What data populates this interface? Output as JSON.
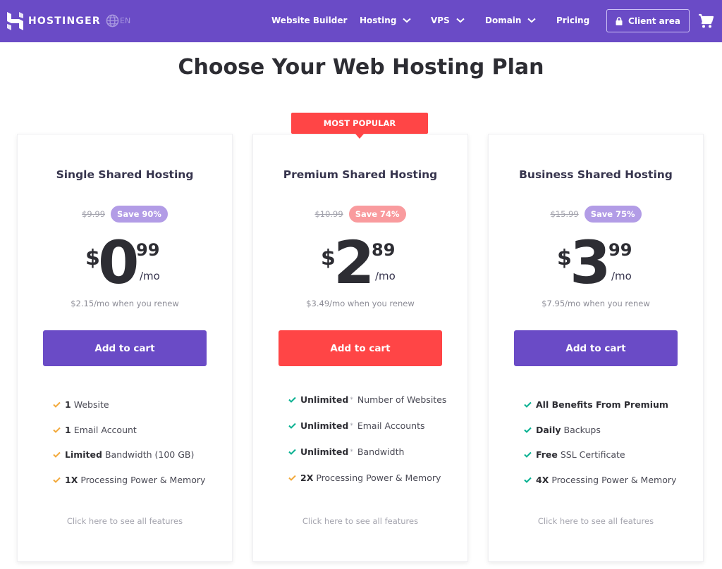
{
  "header": {
    "brand": "HOSTINGER",
    "language": "EN",
    "nav": [
      {
        "label": "Website Builder",
        "dropdown": false
      },
      {
        "label": "Hosting",
        "dropdown": true
      },
      {
        "label": "VPS",
        "dropdown": true
      },
      {
        "label": "Domain",
        "dropdown": true
      },
      {
        "label": "Pricing",
        "dropdown": false
      }
    ],
    "client_area": "Client area",
    "icons": {
      "logo": "hostinger-logo",
      "language": "globe-icon",
      "lock": "lock-icon",
      "cart": "shopping-cart-icon"
    }
  },
  "page_title": "Choose Your Web Hosting Plan",
  "colors": {
    "brand_purple": "#6a4bc6",
    "accent_red": "#ff4546",
    "badge_purple": "#b29ce6",
    "badge_pink": "#f99b9e",
    "check_green": "#00b090",
    "check_orange": "#f2a93b"
  },
  "plans": [
    {
      "name": "Single Shared Hosting",
      "old_price": "$9.99",
      "save": "Save 90%",
      "currency": "$",
      "price_int": "0",
      "price_cents": "99",
      "per": "/mo",
      "renew": "$2.15/mo when you renew",
      "button": "Add to cart",
      "features": [
        {
          "bold": "1",
          "text": "Website",
          "asterisk": false,
          "check": "orange"
        },
        {
          "bold": "1",
          "text": "Email Account",
          "asterisk": false,
          "check": "orange"
        },
        {
          "bold": "Limited",
          "text": "Bandwidth (100 GB)",
          "asterisk": false,
          "check": "orange"
        },
        {
          "bold": "1X",
          "text": "Processing Power & Memory",
          "asterisk": false,
          "check": "orange"
        }
      ],
      "see_all": "Click here to see all features"
    },
    {
      "name": "Premium Shared Hosting",
      "ribbon": "MOST POPULAR",
      "old_price": "$10.99",
      "save": "Save 74%",
      "currency": "$",
      "price_int": "2",
      "price_cents": "89",
      "per": "/mo",
      "renew": "$3.49/mo when you renew",
      "button": "Add to cart",
      "features": [
        {
          "bold": "Unlimited",
          "text": "Number of Websites",
          "asterisk": true,
          "check": "green"
        },
        {
          "bold": "Unlimited",
          "text": "Email Accounts",
          "asterisk": true,
          "check": "green"
        },
        {
          "bold": "Unlimited",
          "text": "Bandwidth",
          "asterisk": true,
          "check": "green"
        },
        {
          "bold": "2X",
          "text": "Processing Power & Memory",
          "asterisk": false,
          "check": "orange"
        }
      ],
      "see_all": "Click here to see all features"
    },
    {
      "name": "Business Shared Hosting",
      "old_price": "$15.99",
      "save": "Save 75%",
      "currency": "$",
      "price_int": "3",
      "price_cents": "99",
      "per": "/mo",
      "renew": "$7.95/mo when you renew",
      "button": "Add to cart",
      "features": [
        {
          "bold": "All Benefits From Premium",
          "text": "",
          "asterisk": false,
          "check": "green"
        },
        {
          "bold": "Daily",
          "text": "Backups",
          "asterisk": false,
          "check": "green"
        },
        {
          "bold": "Free",
          "text": "SSL Certificate",
          "asterisk": false,
          "check": "green"
        },
        {
          "bold": "4X",
          "text": "Processing Power & Memory",
          "asterisk": false,
          "check": "green"
        }
      ],
      "see_all": "Click here to see all features"
    }
  ]
}
